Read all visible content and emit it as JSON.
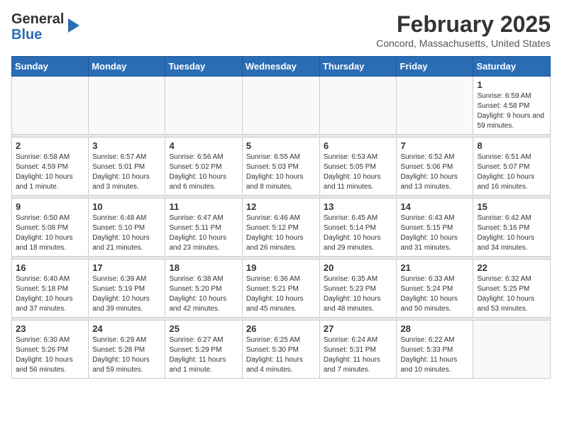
{
  "logo": {
    "general": "General",
    "blue": "Blue"
  },
  "title": "February 2025",
  "location": "Concord, Massachusetts, United States",
  "days_of_week": [
    "Sunday",
    "Monday",
    "Tuesday",
    "Wednesday",
    "Thursday",
    "Friday",
    "Saturday"
  ],
  "weeks": [
    [
      {
        "day": "",
        "info": ""
      },
      {
        "day": "",
        "info": ""
      },
      {
        "day": "",
        "info": ""
      },
      {
        "day": "",
        "info": ""
      },
      {
        "day": "",
        "info": ""
      },
      {
        "day": "",
        "info": ""
      },
      {
        "day": "1",
        "info": "Sunrise: 6:59 AM\nSunset: 4:58 PM\nDaylight: 9 hours and 59 minutes."
      }
    ],
    [
      {
        "day": "2",
        "info": "Sunrise: 6:58 AM\nSunset: 4:59 PM\nDaylight: 10 hours and 1 minute."
      },
      {
        "day": "3",
        "info": "Sunrise: 6:57 AM\nSunset: 5:01 PM\nDaylight: 10 hours and 3 minutes."
      },
      {
        "day": "4",
        "info": "Sunrise: 6:56 AM\nSunset: 5:02 PM\nDaylight: 10 hours and 6 minutes."
      },
      {
        "day": "5",
        "info": "Sunrise: 6:55 AM\nSunset: 5:03 PM\nDaylight: 10 hours and 8 minutes."
      },
      {
        "day": "6",
        "info": "Sunrise: 6:53 AM\nSunset: 5:05 PM\nDaylight: 10 hours and 11 minutes."
      },
      {
        "day": "7",
        "info": "Sunrise: 6:52 AM\nSunset: 5:06 PM\nDaylight: 10 hours and 13 minutes."
      },
      {
        "day": "8",
        "info": "Sunrise: 6:51 AM\nSunset: 5:07 PM\nDaylight: 10 hours and 16 minutes."
      }
    ],
    [
      {
        "day": "9",
        "info": "Sunrise: 6:50 AM\nSunset: 5:08 PM\nDaylight: 10 hours and 18 minutes."
      },
      {
        "day": "10",
        "info": "Sunrise: 6:48 AM\nSunset: 5:10 PM\nDaylight: 10 hours and 21 minutes."
      },
      {
        "day": "11",
        "info": "Sunrise: 6:47 AM\nSunset: 5:11 PM\nDaylight: 10 hours and 23 minutes."
      },
      {
        "day": "12",
        "info": "Sunrise: 6:46 AM\nSunset: 5:12 PM\nDaylight: 10 hours and 26 minutes."
      },
      {
        "day": "13",
        "info": "Sunrise: 6:45 AM\nSunset: 5:14 PM\nDaylight: 10 hours and 29 minutes."
      },
      {
        "day": "14",
        "info": "Sunrise: 6:43 AM\nSunset: 5:15 PM\nDaylight: 10 hours and 31 minutes."
      },
      {
        "day": "15",
        "info": "Sunrise: 6:42 AM\nSunset: 5:16 PM\nDaylight: 10 hours and 34 minutes."
      }
    ],
    [
      {
        "day": "16",
        "info": "Sunrise: 6:40 AM\nSunset: 5:18 PM\nDaylight: 10 hours and 37 minutes."
      },
      {
        "day": "17",
        "info": "Sunrise: 6:39 AM\nSunset: 5:19 PM\nDaylight: 10 hours and 39 minutes."
      },
      {
        "day": "18",
        "info": "Sunrise: 6:38 AM\nSunset: 5:20 PM\nDaylight: 10 hours and 42 minutes."
      },
      {
        "day": "19",
        "info": "Sunrise: 6:36 AM\nSunset: 5:21 PM\nDaylight: 10 hours and 45 minutes."
      },
      {
        "day": "20",
        "info": "Sunrise: 6:35 AM\nSunset: 5:23 PM\nDaylight: 10 hours and 48 minutes."
      },
      {
        "day": "21",
        "info": "Sunrise: 6:33 AM\nSunset: 5:24 PM\nDaylight: 10 hours and 50 minutes."
      },
      {
        "day": "22",
        "info": "Sunrise: 6:32 AM\nSunset: 5:25 PM\nDaylight: 10 hours and 53 minutes."
      }
    ],
    [
      {
        "day": "23",
        "info": "Sunrise: 6:30 AM\nSunset: 5:26 PM\nDaylight: 10 hours and 56 minutes."
      },
      {
        "day": "24",
        "info": "Sunrise: 6:29 AM\nSunset: 5:28 PM\nDaylight: 10 hours and 59 minutes."
      },
      {
        "day": "25",
        "info": "Sunrise: 6:27 AM\nSunset: 5:29 PM\nDaylight: 11 hours and 1 minute."
      },
      {
        "day": "26",
        "info": "Sunrise: 6:25 AM\nSunset: 5:30 PM\nDaylight: 11 hours and 4 minutes."
      },
      {
        "day": "27",
        "info": "Sunrise: 6:24 AM\nSunset: 5:31 PM\nDaylight: 11 hours and 7 minutes."
      },
      {
        "day": "28",
        "info": "Sunrise: 6:22 AM\nSunset: 5:33 PM\nDaylight: 11 hours and 10 minutes."
      },
      {
        "day": "",
        "info": ""
      }
    ]
  ]
}
